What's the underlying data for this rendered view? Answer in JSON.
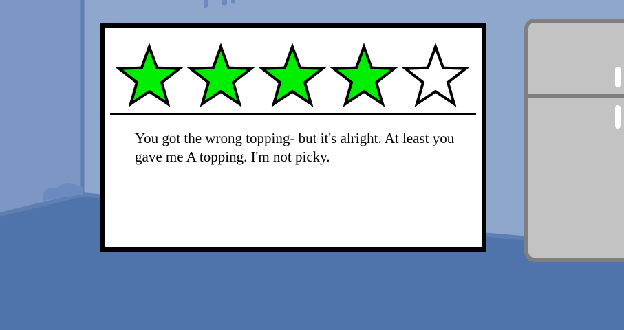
{
  "review": {
    "rating": 4,
    "max_rating": 5,
    "text": "You got the wrong topping- but it's alright. At least you gave me A topping. I'm not picky."
  },
  "colors": {
    "wall": "#8fa6cd",
    "wall_left": "#7d96c4",
    "floor": "#4f74ac",
    "star_filled": "#00ee00",
    "star_empty": "#ffffff",
    "fridge": "#c3c3c3",
    "fridge_outline": "#7f7f7f"
  },
  "icons": {
    "filled_star": "star-filled-icon",
    "empty_star": "star-empty-icon",
    "fridge": "fridge-icon"
  }
}
